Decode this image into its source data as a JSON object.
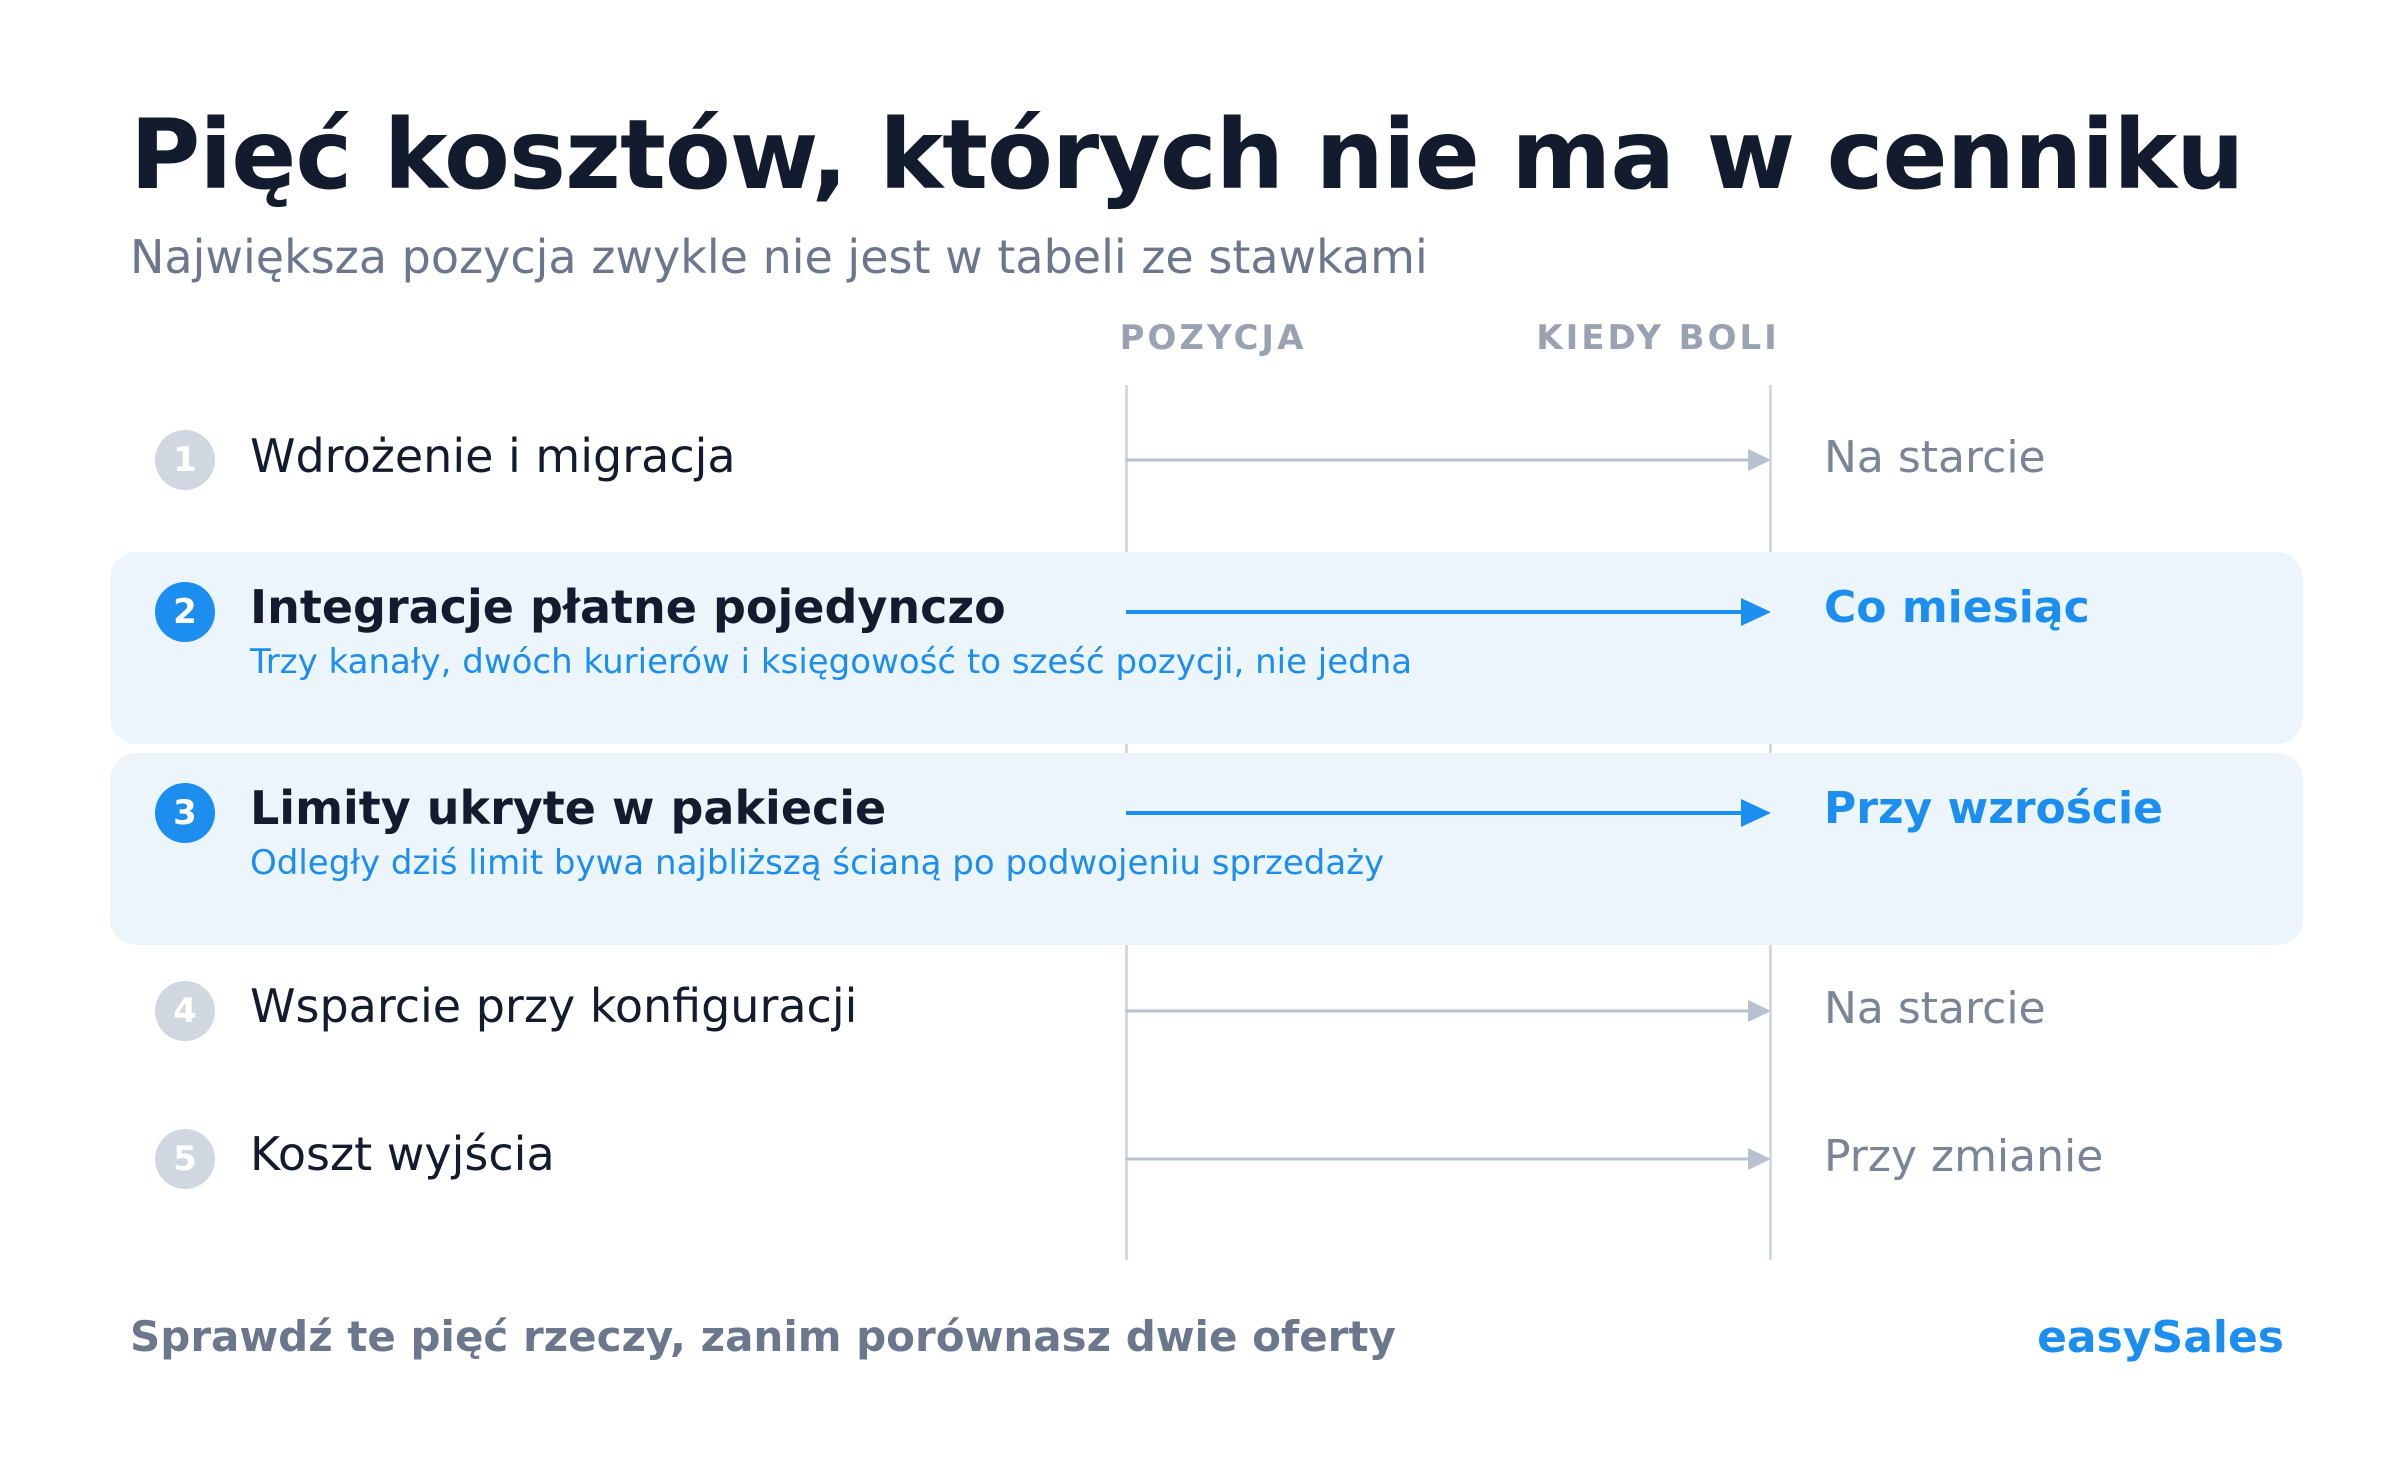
{
  "header": {
    "title": "Pięć kosztów, których nie ma w cenniku",
    "subtitle": "Największa pozycja zwykle nie jest w tabeli ze stawkami"
  },
  "columns": {
    "position": "POZYCJA",
    "when": "KIEDY BOLI"
  },
  "rows": [
    {
      "num": "1",
      "label": "Wdrożenie i migracja",
      "note": "",
      "when": "Na starcie",
      "highlighted": false
    },
    {
      "num": "2",
      "label": "Integracje płatne pojedynczo",
      "note": "Trzy kanały, dwóch kurierów i księgowość to sześć pozycji, nie jedna",
      "when": "Co miesiąc",
      "highlighted": true
    },
    {
      "num": "3",
      "label": "Limity ukryte w pakiecie",
      "note": "Odległy dziś limit bywa najbliższą ścianą po podwojeniu sprzedaży",
      "when": "Przy wzroście",
      "highlighted": true
    },
    {
      "num": "4",
      "label": "Wsparcie przy konfiguracji",
      "note": "",
      "when": "Na starcie",
      "highlighted": false
    },
    {
      "num": "5",
      "label": "Koszt wyjścia",
      "note": "",
      "when": "Przy zmianie",
      "highlighted": false
    }
  ],
  "footer": {
    "text": "Sprawdź te pięć rzeczy, zanim porównasz dwie oferty",
    "brand": "easySales"
  },
  "colors": {
    "accent": "#1b8ef0",
    "muted": "#d1d7e0",
    "highlight_bg": "#ecf5fc"
  }
}
